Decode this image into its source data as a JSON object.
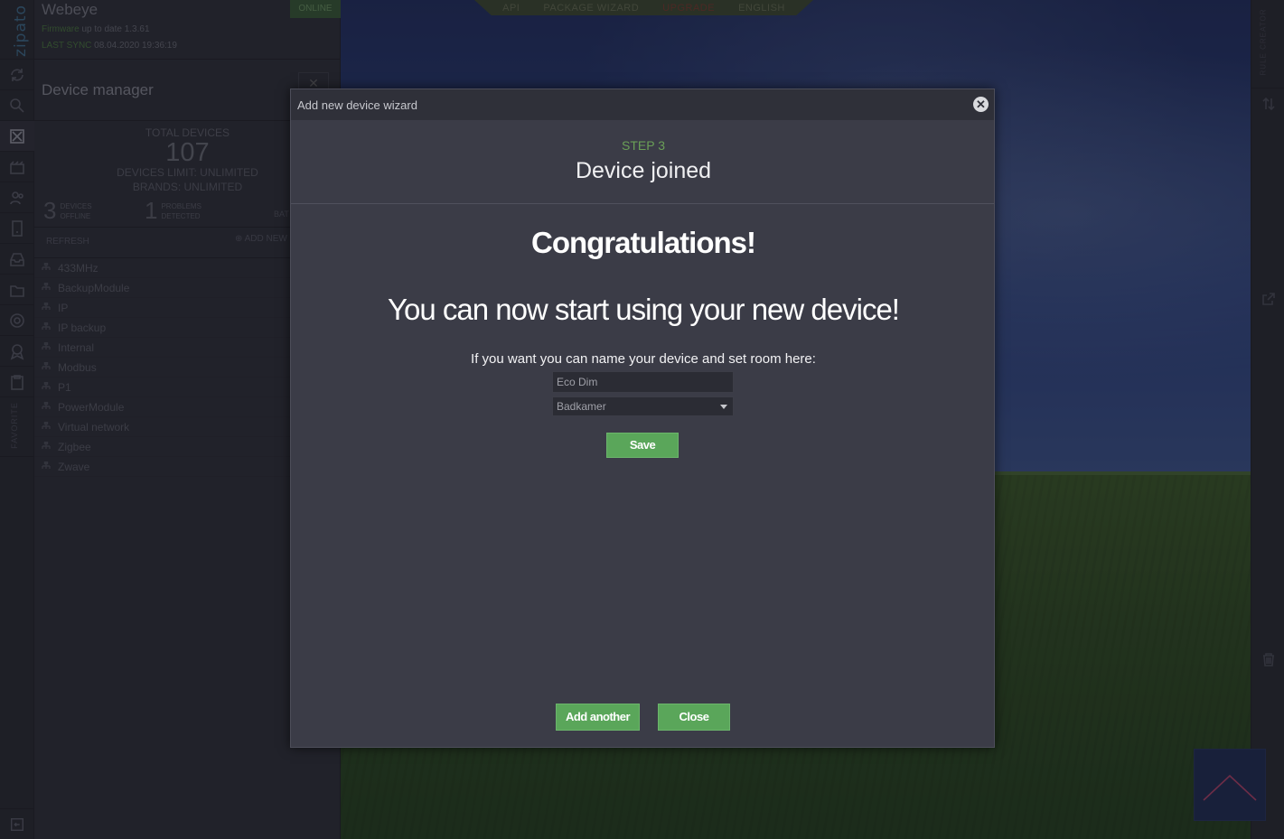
{
  "rail": {
    "logo": "zipato",
    "favorite": "FAVORITE"
  },
  "panel": {
    "name": "Webeye",
    "firmware_label": "Firmware",
    "firmware_text": "up to date 1.3.61",
    "sync_label": "LAST SYNC",
    "sync_value": "08.04.2020 19:36:19",
    "online": "ONLINE",
    "title": "Device manager",
    "stats": {
      "total_label": "TOTAL DEVICES",
      "total": "107",
      "limit": "DEVICES LIMIT: UNLIMITED",
      "brands": "BRANDS: UNLIMITED",
      "offline_count": "3",
      "offline_l1": "DEVICES",
      "offline_l2": "OFFLINE",
      "problems_count": "1",
      "problems_l1": "PROBLEMS",
      "problems_l2": "DETECTED",
      "bat": "BAT"
    },
    "refresh": "REFRESH",
    "add_new": "ADD NEW",
    "items": [
      {
        "label": "433MHz"
      },
      {
        "label": "BackupModule"
      },
      {
        "label": "IP"
      },
      {
        "label": "IP backup"
      },
      {
        "label": "Internal"
      },
      {
        "label": "Modbus"
      },
      {
        "label": "P1"
      },
      {
        "label": "PowerModule"
      },
      {
        "label": "Virtual network"
      },
      {
        "label": "Zigbee"
      },
      {
        "label": "Zwave"
      }
    ]
  },
  "topnav": {
    "api": "API",
    "wizard": "PACKAGE WIZARD",
    "upgrade": "UPGRADE",
    "language": "ENGLISH"
  },
  "rrail": {
    "rule_creator": "RULE CREATOR"
  },
  "modal": {
    "title": "Add new device wizard",
    "step": "STEP 3",
    "step_title": "Device joined",
    "congrats": "Congratulations!",
    "start": "You can now start using your new device!",
    "hint": "If you want you can name your device and set room here:",
    "name_value": "Eco Dim",
    "room_value": "Badkamer",
    "save": "Save",
    "add_another": "Add another",
    "close": "Close"
  },
  "colors": {
    "accent_green": "#5aa65a",
    "step_green": "#6a9f57",
    "modal_bg": "#3b3c47"
  }
}
